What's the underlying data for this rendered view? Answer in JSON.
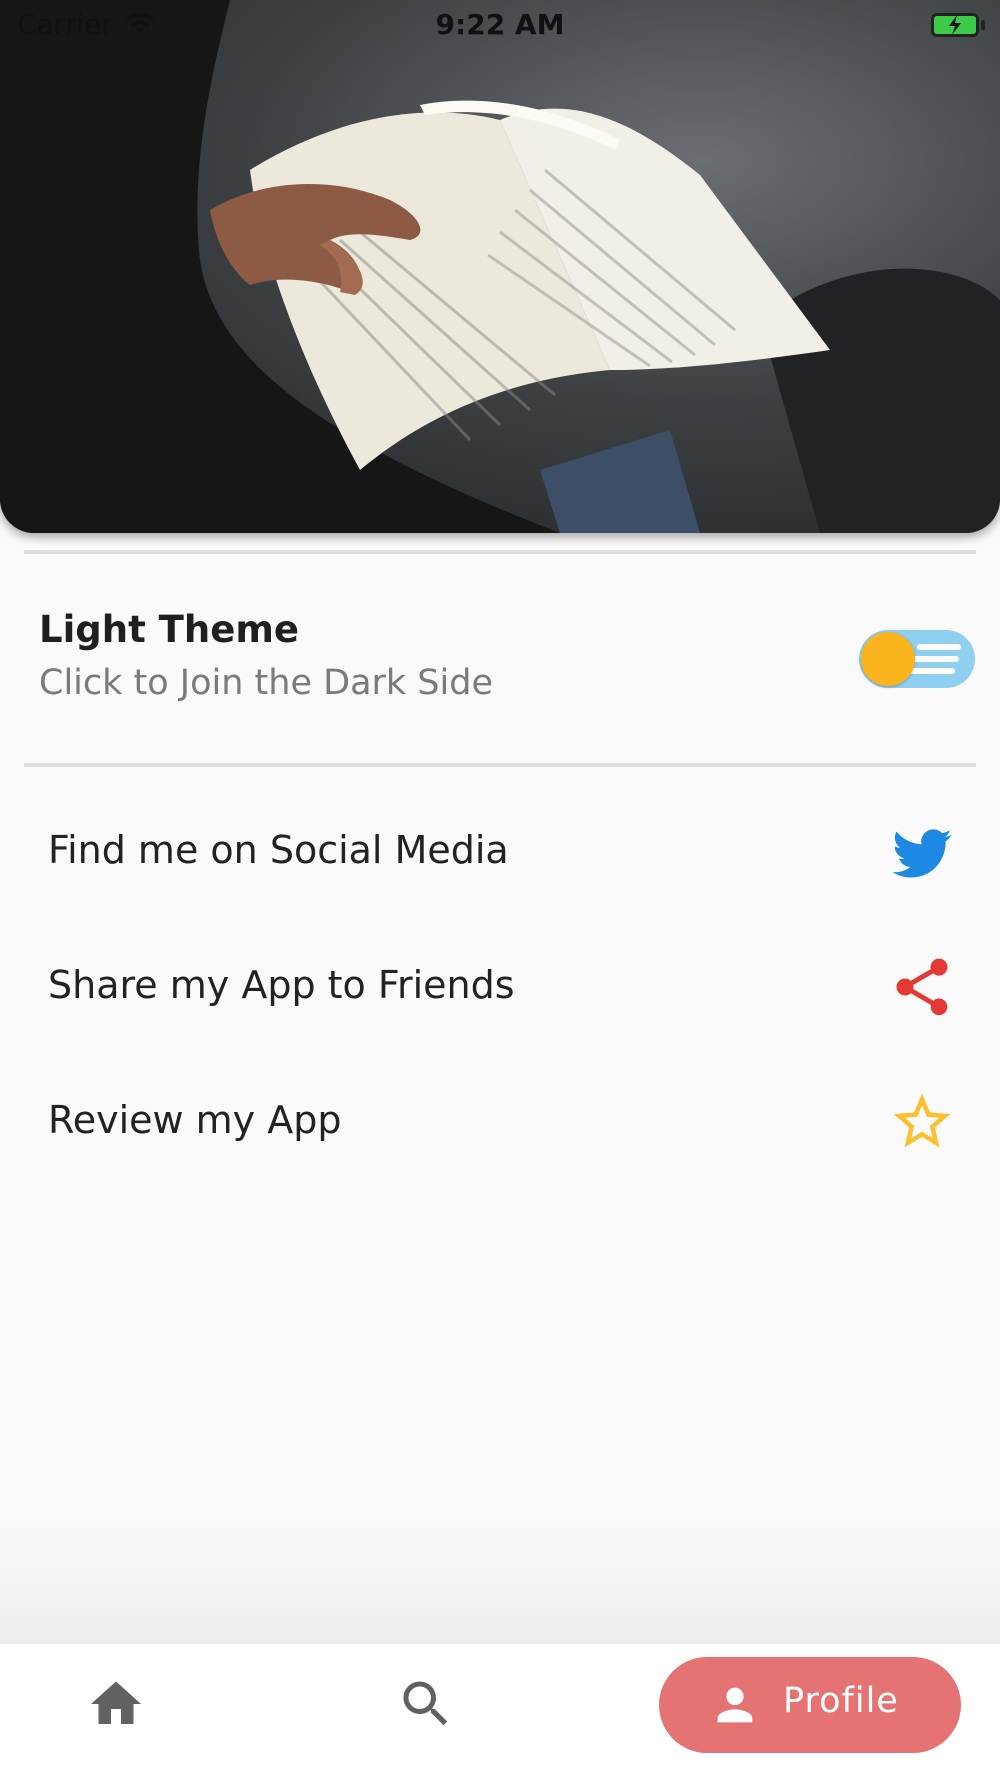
{
  "status_bar": {
    "carrier": "Carrier",
    "time": "9:22 AM"
  },
  "header": {
    "image": "person-reading-book-photo"
  },
  "theme_setting": {
    "title": "Light Theme",
    "subtitle": "Click to Join the Dark Side",
    "toggle_state": "light",
    "colors": {
      "knob": "#fbb41e",
      "track": "#8fcff0"
    }
  },
  "menu": {
    "items": [
      {
        "label": "Find me on Social Media",
        "icon": "twitter-icon",
        "color": "#1e88e5"
      },
      {
        "label": "Share my App to Friends",
        "icon": "share-icon",
        "color": "#e53935"
      },
      {
        "label": "Review my App",
        "icon": "star-outline-icon",
        "color": "#fbc02d"
      }
    ]
  },
  "bottom_nav": {
    "items": [
      {
        "icon": "home-icon"
      },
      {
        "icon": "search-icon"
      },
      {
        "icon": "person-icon",
        "label": "Profile",
        "active": true
      }
    ],
    "active_color": "#e57373"
  }
}
